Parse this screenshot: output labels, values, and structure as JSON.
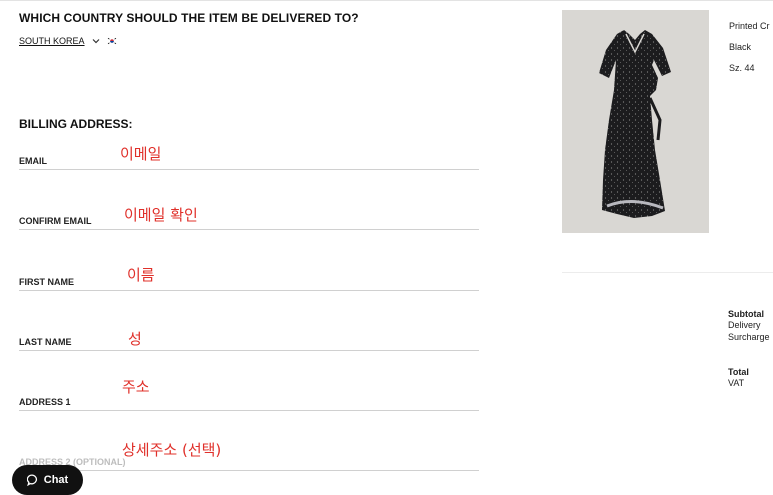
{
  "country": {
    "question": "WHICH COUNTRY SHOULD THE ITEM BE DELIVERED TO?",
    "selected": "SOUTH KOREA"
  },
  "billing": {
    "heading": "BILLING ADDRESS:",
    "fields": [
      {
        "label": "EMAIL",
        "annotation": "이메일"
      },
      {
        "label": "CONFIRM EMAIL",
        "annotation": "이메일 확인"
      },
      {
        "label": "FIRST NAME",
        "annotation": "이름"
      },
      {
        "label": "LAST NAME",
        "annotation": "성"
      },
      {
        "label": "ADDRESS 1",
        "annotation": "주소"
      },
      {
        "label": "ADDRESS 2 (OPTIONAL)",
        "annotation": "상세주소 (선택)"
      }
    ]
  },
  "product": {
    "name": "Printed Cr",
    "color": "Black",
    "size": "Sz. 44"
  },
  "summary": {
    "subtotal_label": "Subtotal",
    "delivery_label": "Delivery",
    "surcharge_label": "Surcharge",
    "total_label": "Total",
    "vat_label": "VAT"
  },
  "chat": {
    "label": "Chat"
  },
  "colors": {
    "annotation": "#e0302a",
    "chat_bg": "#111111",
    "image_bg": "#d9d7d3"
  }
}
